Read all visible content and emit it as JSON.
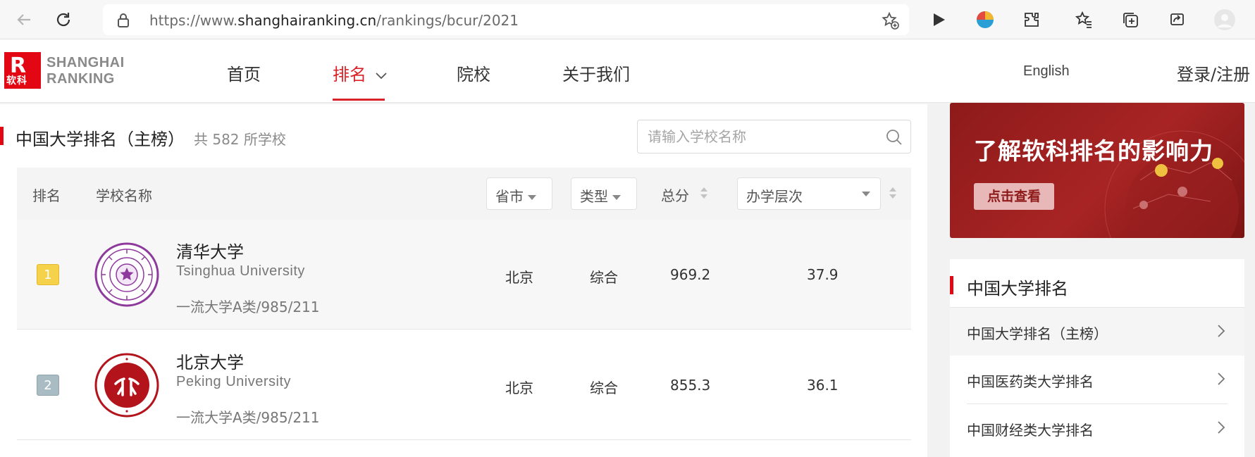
{
  "browser": {
    "url_prefix": "https://www.",
    "url_domain": "shanghairanking.cn",
    "url_path": "/rankings/bcur/2021"
  },
  "header": {
    "logo_chars": "软科",
    "logo_line1": "SHANGHAI",
    "logo_line2": "RANKING",
    "menu": [
      {
        "label": "首页"
      },
      {
        "label": "排名"
      },
      {
        "label": "院校"
      },
      {
        "label": "关于我们"
      }
    ],
    "lang": "English",
    "login": "登录/注册"
  },
  "main": {
    "title": "中国大学排名（主榜）",
    "count": "共 582 所学校",
    "search_placeholder": "请输入学校名称",
    "columns": {
      "rank": "排名",
      "name": "学校名称",
      "province": "省市",
      "type": "类型",
      "score": "总分",
      "level": "办学层次"
    },
    "rows": [
      {
        "rank": "1",
        "name_cn": "清华大学",
        "name_en": "Tsinghua University",
        "tags": "一流大学A类/985/211",
        "province": "北京",
        "type": "综合",
        "score": "969.2",
        "level": "37.9"
      },
      {
        "rank": "2",
        "name_cn": "北京大学",
        "name_en": "Peking University",
        "tags": "一流大学A类/985/211",
        "province": "北京",
        "type": "综合",
        "score": "855.3",
        "level": "36.1"
      }
    ]
  },
  "sidebar": {
    "banner_title": "了解软科排名的影响力",
    "banner_button": "点击查看",
    "card_title": "中国大学排名",
    "items": [
      {
        "label": "中国大学排名（主榜）"
      },
      {
        "label": "中国医药类大学排名"
      },
      {
        "label": "中国财经类大学排名"
      }
    ]
  },
  "colors": {
    "brand_red": "#e30613",
    "active_red": "#d8232a",
    "banner": "#8e1a1a"
  }
}
